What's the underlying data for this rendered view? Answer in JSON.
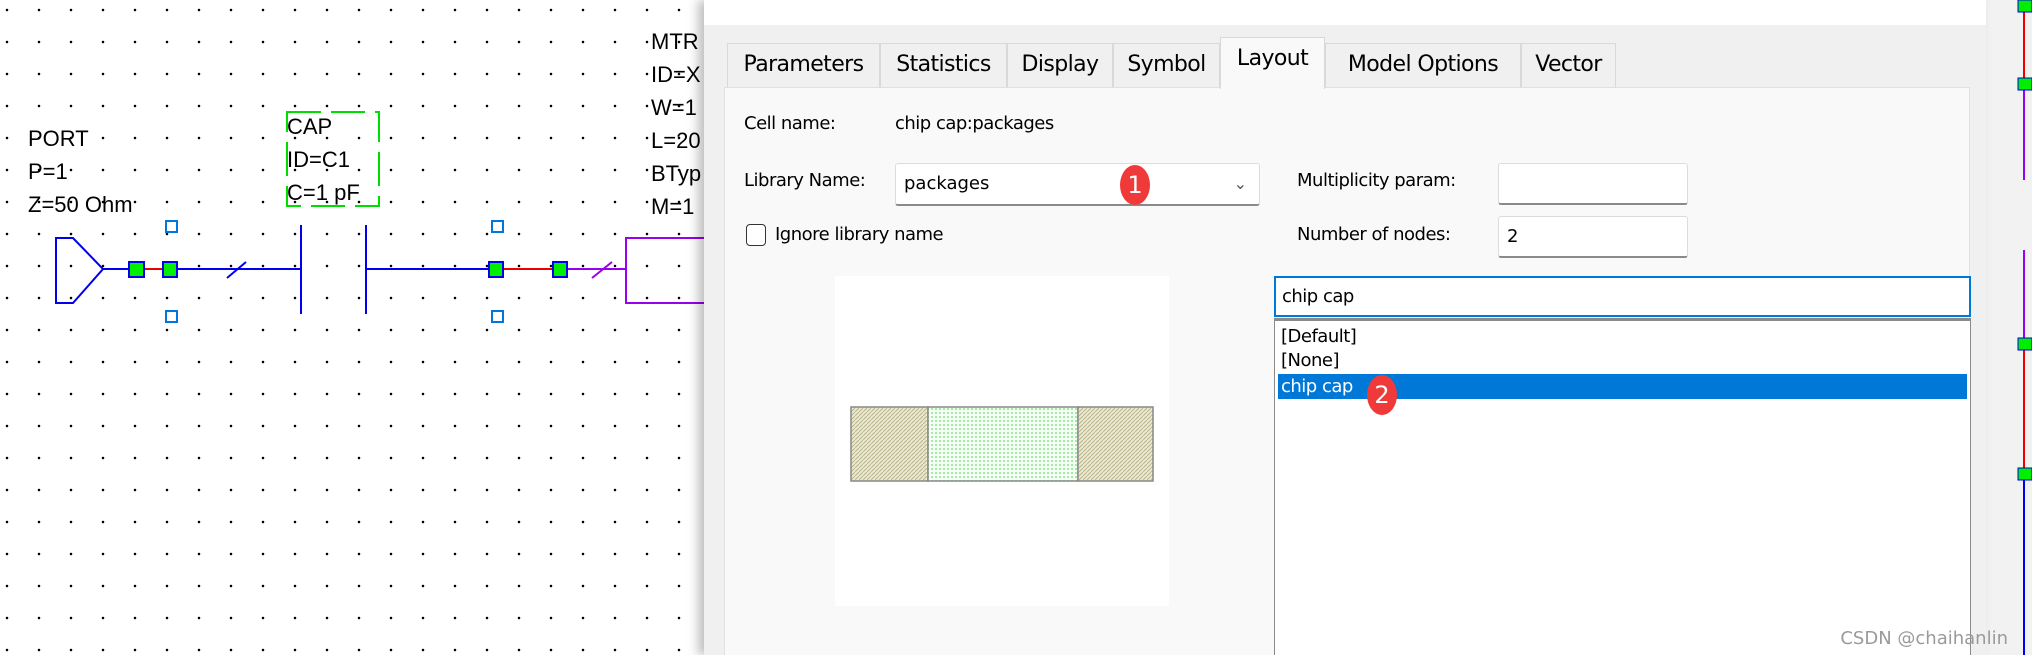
{
  "schematic": {
    "port": {
      "lines": [
        "PORT",
        "P=1",
        "Z=50 Ohm"
      ]
    },
    "cap": {
      "lines": [
        "CAP",
        "ID=C1",
        "C=1 pF"
      ]
    },
    "mtrl": {
      "lines": [
        "MTR",
        "ID=X",
        "W=1",
        "L=20",
        "BTyp",
        "M=1"
      ]
    },
    "colors": {
      "wire": "#0000ee",
      "node": "#00ee00",
      "short": "#ee0000",
      "mtrl": "#9900ee",
      "selection": "#00dd00",
      "handle": "#0077dd"
    }
  },
  "dialog": {
    "tabs": [
      {
        "label": "Parameters"
      },
      {
        "label": "Statistics"
      },
      {
        "label": "Display"
      },
      {
        "label": "Symbol"
      },
      {
        "label": "Layout",
        "active": true
      },
      {
        "label": "Model Options"
      },
      {
        "label": "Vector"
      }
    ],
    "layout": {
      "cell_name_label": "Cell name:",
      "cell_name_value": "chip cap:packages",
      "library_name_label": "Library Name:",
      "library_name_value": "packages",
      "ignore_library_label": "Ignore library name",
      "ignore_library_checked": false,
      "multiplicity_label": "Multiplicity param:",
      "multiplicity_value": "",
      "nodes_label": "Number of nodes:",
      "nodes_value": "2",
      "cell_search_value": "chip cap",
      "cell_list": [
        {
          "label": "[Default]",
          "selected": false
        },
        {
          "label": "[None]",
          "selected": false
        },
        {
          "label": "chip cap",
          "selected": true
        }
      ],
      "accent_color": "#0078d7"
    }
  },
  "annotations": {
    "badge1": "1",
    "badge2": "2"
  },
  "watermark": "CSDN @chaihanlin"
}
